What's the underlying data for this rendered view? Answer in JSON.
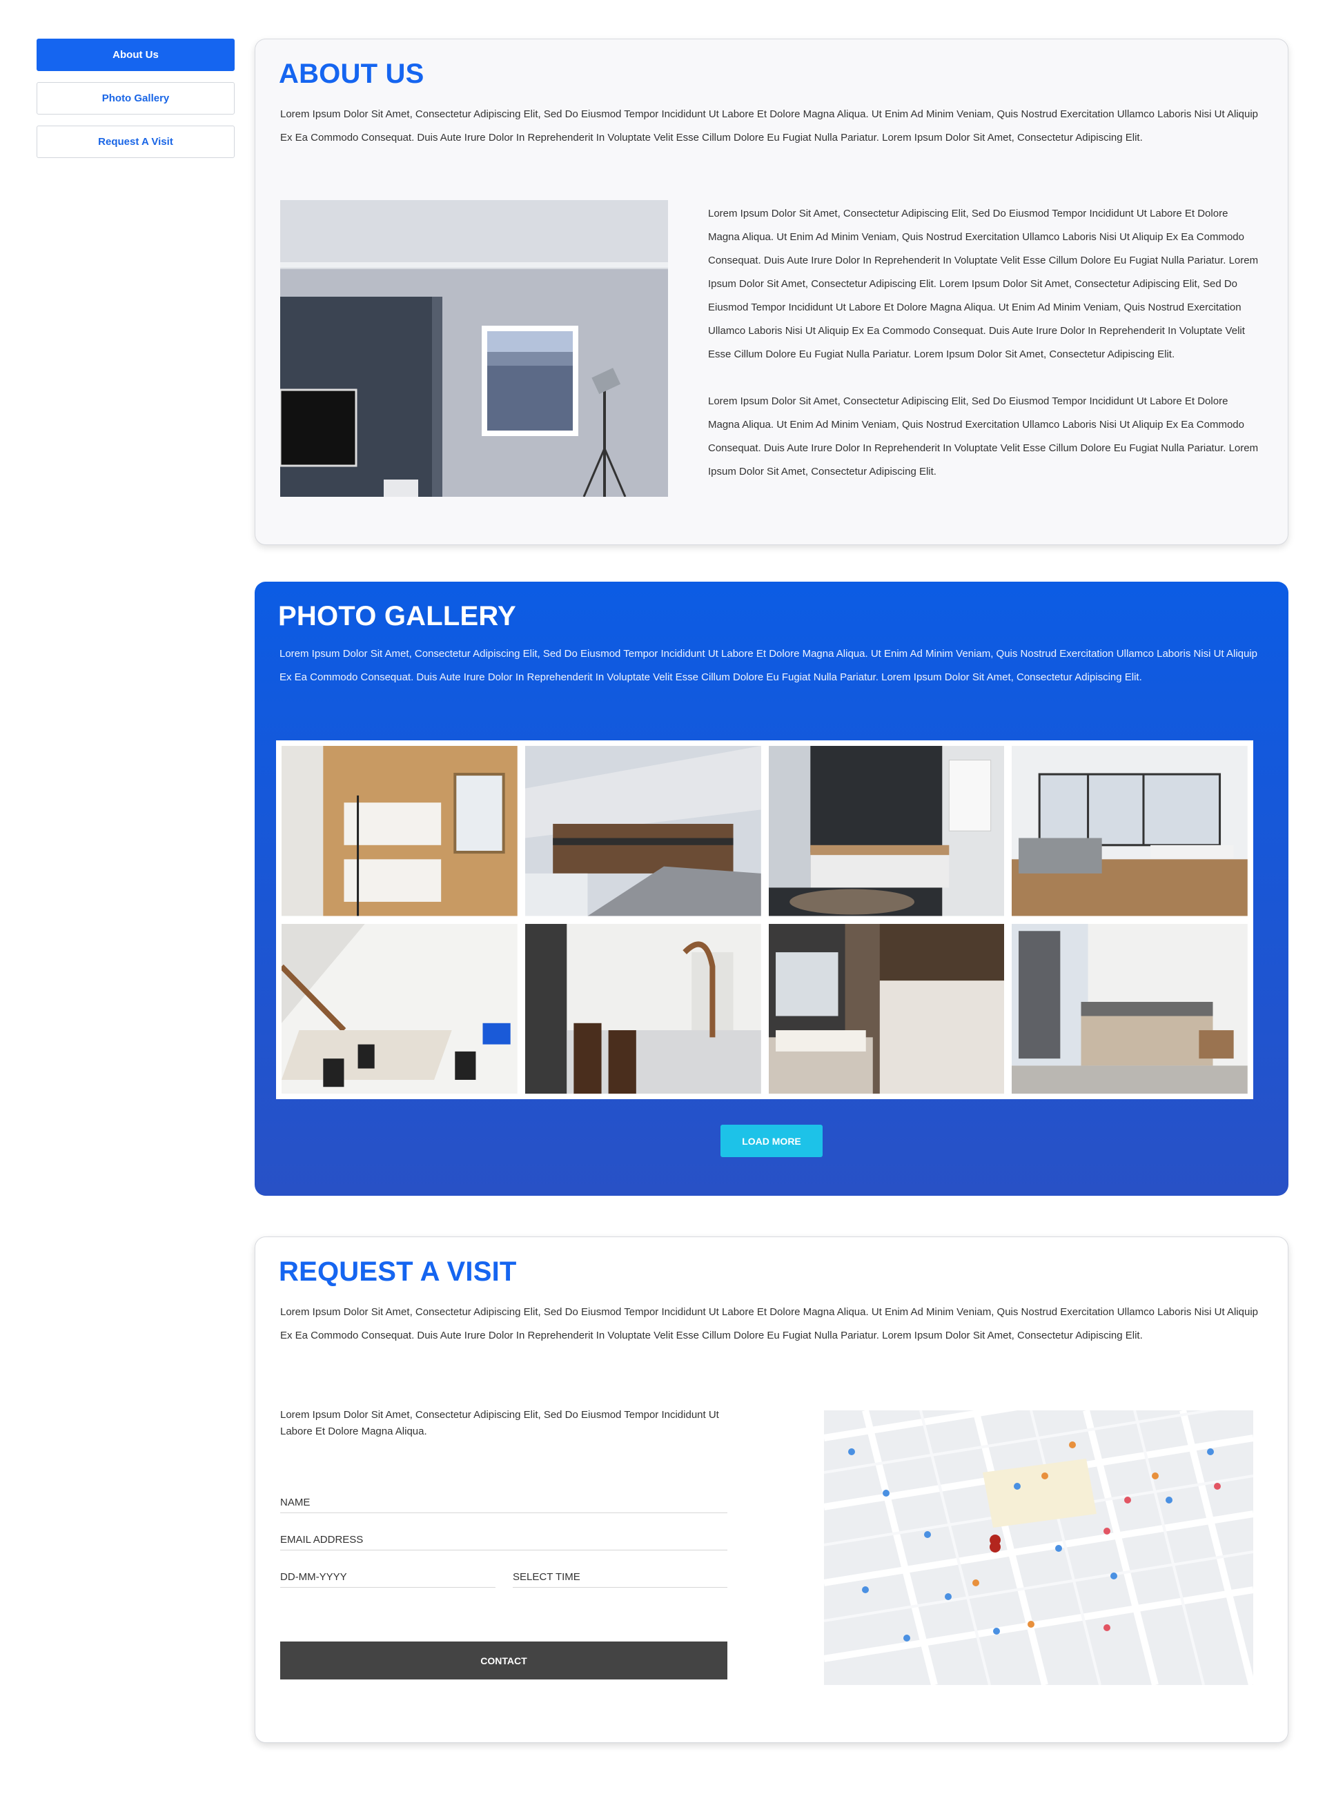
{
  "sidebar": {
    "items": [
      {
        "label": "About Us"
      },
      {
        "label": "Photo Gallery"
      },
      {
        "label": "Request A Visit"
      }
    ]
  },
  "about": {
    "title": "ABOUT US",
    "intro": "Lorem Ipsum Dolor Sit Amet, Consectetur Adipiscing Elit, Sed Do Eiusmod Tempor Incididunt Ut Labore Et Dolore Magna Aliqua. Ut Enim Ad Minim Veniam, Quis Nostrud Exercitation Ullamco Laboris Nisi Ut Aliquip Ex Ea Commodo Consequat. Duis Aute Irure Dolor In Reprehenderit In Voluptate Velit Esse Cillum Dolore Eu Fugiat Nulla Pariatur. Lorem Ipsum Dolor Sit Amet, Consectetur Adipiscing Elit.",
    "paragraph1": "Lorem Ipsum Dolor Sit Amet, Consectetur Adipiscing Elit, Sed Do Eiusmod Tempor Incididunt Ut Labore Et Dolore Magna Aliqua. Ut Enim Ad Minim Veniam, Quis Nostrud Exercitation Ullamco Laboris Nisi Ut Aliquip Ex Ea Commodo Consequat. Duis Aute Irure Dolor In Reprehenderit In Voluptate Velit Esse Cillum Dolore Eu Fugiat Nulla Pariatur. Lorem Ipsum Dolor Sit Amet, Consectetur Adipiscing Elit. Lorem Ipsum Dolor Sit Amet, Consectetur Adipiscing Elit, Sed Do Eiusmod Tempor Incididunt Ut Labore Et Dolore Magna Aliqua. Ut Enim Ad Minim Veniam, Quis Nostrud Exercitation Ullamco Laboris Nisi Ut Aliquip Ex Ea Commodo Consequat. Duis Aute Irure Dolor In Reprehenderit In Voluptate Velit Esse Cillum Dolore Eu Fugiat Nulla Pariatur. Lorem Ipsum Dolor Sit Amet, Consectetur Adipiscing Elit.",
    "paragraph2": "Lorem Ipsum Dolor Sit Amet, Consectetur Adipiscing Elit, Sed Do Eiusmod Tempor Incididunt Ut Labore Et Dolore Magna Aliqua. Ut Enim Ad Minim Veniam, Quis Nostrud Exercitation Ullamco Laboris Nisi Ut Aliquip Ex Ea Commodo Consequat. Duis Aute Irure Dolor In Reprehenderit In Voluptate Velit Esse Cillum Dolore Eu Fugiat Nulla Pariatur. Lorem Ipsum Dolor Sit Amet, Consectetur Adipiscing Elit."
  },
  "gallery": {
    "title": "PHOTO GALLERY",
    "intro": "Lorem Ipsum Dolor Sit Amet, Consectetur Adipiscing Elit, Sed Do Eiusmod Tempor Incididunt Ut Labore Et Dolore Magna Aliqua. Ut Enim Ad Minim Veniam, Quis Nostrud Exercitation Ullamco Laboris Nisi Ut Aliquip Ex Ea Commodo Consequat. Duis Aute Irure Dolor In Reprehenderit In Voluptate Velit Esse Cillum Dolore Eu Fugiat Nulla Pariatur. Lorem Ipsum Dolor Sit Amet, Consectetur Adipiscing Elit.",
    "load_more": "LOAD MORE"
  },
  "visit": {
    "title": "REQUEST A VISIT",
    "intro": "Lorem Ipsum Dolor Sit Amet, Consectetur Adipiscing Elit, Sed Do Eiusmod Tempor Incididunt Ut Labore Et Dolore Magna Aliqua. Ut Enim Ad Minim Veniam, Quis Nostrud Exercitation Ullamco Laboris Nisi Ut Aliquip Ex Ea Commodo Consequat. Duis Aute Irure Dolor In Reprehenderit In Voluptate Velit Esse Cillum Dolore Eu Fugiat Nulla Pariatur. Lorem Ipsum Dolor Sit Amet, Consectetur Adipiscing Elit.",
    "subtext": "Lorem Ipsum Dolor Sit Amet, Consectetur Adipiscing Elit, Sed Do Eiusmod Tempor Incididunt Ut Labore Et Dolore Magna Aliqua.",
    "name_placeholder": "NAME",
    "email_placeholder": "EMAIL ADDRESS",
    "date_placeholder": "DD-MM-YYYY",
    "time_placeholder": "SELECT TIME",
    "contact": "CONTACT"
  },
  "colors": {
    "accent": "#1565f0",
    "gallery_top": "#0c5ce4",
    "gallery_bottom": "#2851c6",
    "load_more": "#1dc2e8",
    "contact": "#444444"
  }
}
